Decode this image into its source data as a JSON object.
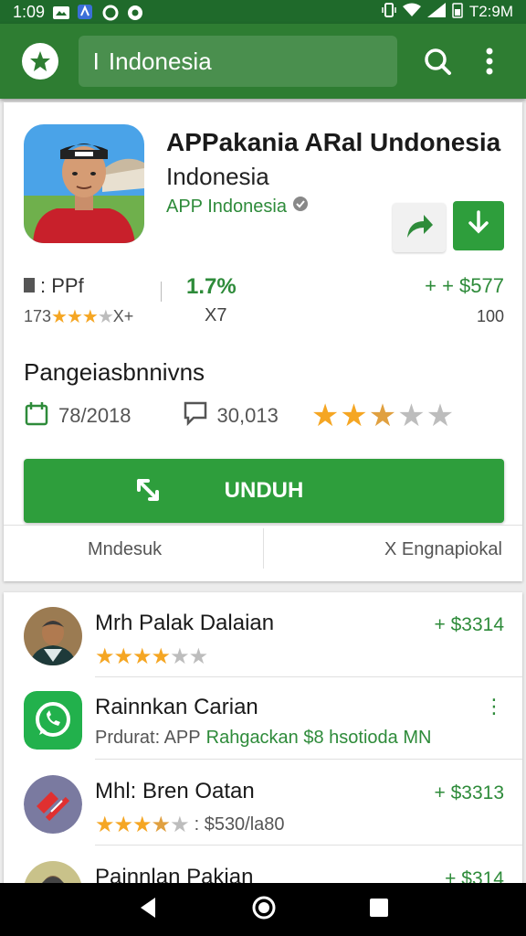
{
  "status": {
    "time": "1:09",
    "right_text": "T2:9M"
  },
  "appbar": {
    "search_cursor": "I",
    "search_text": "Indonesia"
  },
  "app": {
    "title": "APPakania ARal Undonesia",
    "subtitle": "Indonesia",
    "developer": "APP Indonesia"
  },
  "stats": {
    "left_label": ": PPf",
    "left_count": "173",
    "left_stars_tail": "X+",
    "middle_value": "1.7%",
    "middle_sub": "X7",
    "right_value": "+ + $577",
    "right_sub": "100"
  },
  "section": {
    "title": "Pangeiasbnnivns",
    "date": "78/2018",
    "comments": "30,013",
    "rating": 2.5
  },
  "primary_button": {
    "label": "UNDUH"
  },
  "secondary": {
    "left": "Mndesuk",
    "right": "X Engnapiokal"
  },
  "list": [
    {
      "title": "Mrh Palak Dalaian",
      "price": "+ $3314",
      "rating": 3.5
    },
    {
      "title": "Rainnkan Carian",
      "subtitle_prefix": "Prdurat: APP",
      "subtitle_green": "Rahgackan $8 hsotioda MN",
      "menu": "⋮"
    },
    {
      "title": "Mhl: Bren Oatan",
      "price": "+ $3313",
      "rating": 3.5,
      "extra": ": $530/la80"
    },
    {
      "title": "Painnlan Pakian",
      "price": "+ $314"
    }
  ],
  "colors": {
    "primary": "#2e7d32",
    "accent": "#2e9e3c",
    "star": "#f5a623"
  },
  "icons": [
    "app-logo-icon",
    "search-icon",
    "more-vert-icon",
    "share-icon",
    "download-icon",
    "calendar-icon",
    "comment-icon",
    "expand-icon",
    "whatsapp-icon",
    "back-icon",
    "home-icon",
    "recents-icon"
  ]
}
